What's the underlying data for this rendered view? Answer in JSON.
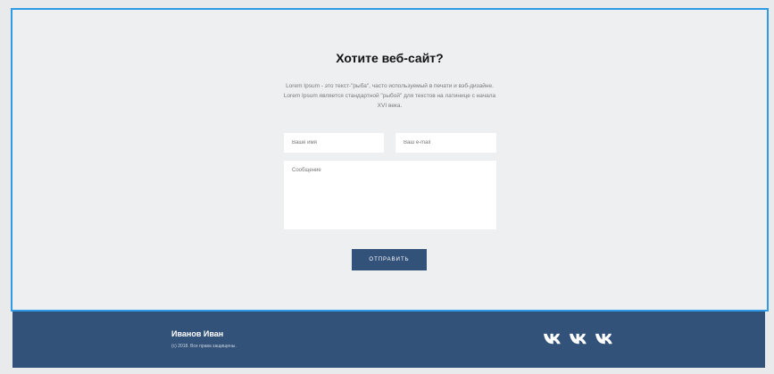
{
  "contact": {
    "title": "Хотите веб-сайт?",
    "description": "Lorem Ipsum - это текст-\"рыба\", часто используемый в печати и вэб-дизайне. Lorem Ipsum является стандартной \"рыбой\" для текстов на латинице с начала XVI века.",
    "name_placeholder": "Ваше имя",
    "email_placeholder": "Ваш e-mail",
    "message_placeholder": "Сообщение",
    "submit_label": "ОТПРАВИТЬ"
  },
  "footer": {
    "author": "Иванов Иван",
    "copyright": "(c) 2018. Все права защищены.",
    "social": [
      {
        "icon": "vk-icon"
      },
      {
        "icon": "vk-icon"
      },
      {
        "icon": "vk-icon"
      }
    ]
  },
  "colors": {
    "accent_border": "#2f9be6",
    "brand": "#33527a",
    "section_bg": "#eeeff0"
  }
}
